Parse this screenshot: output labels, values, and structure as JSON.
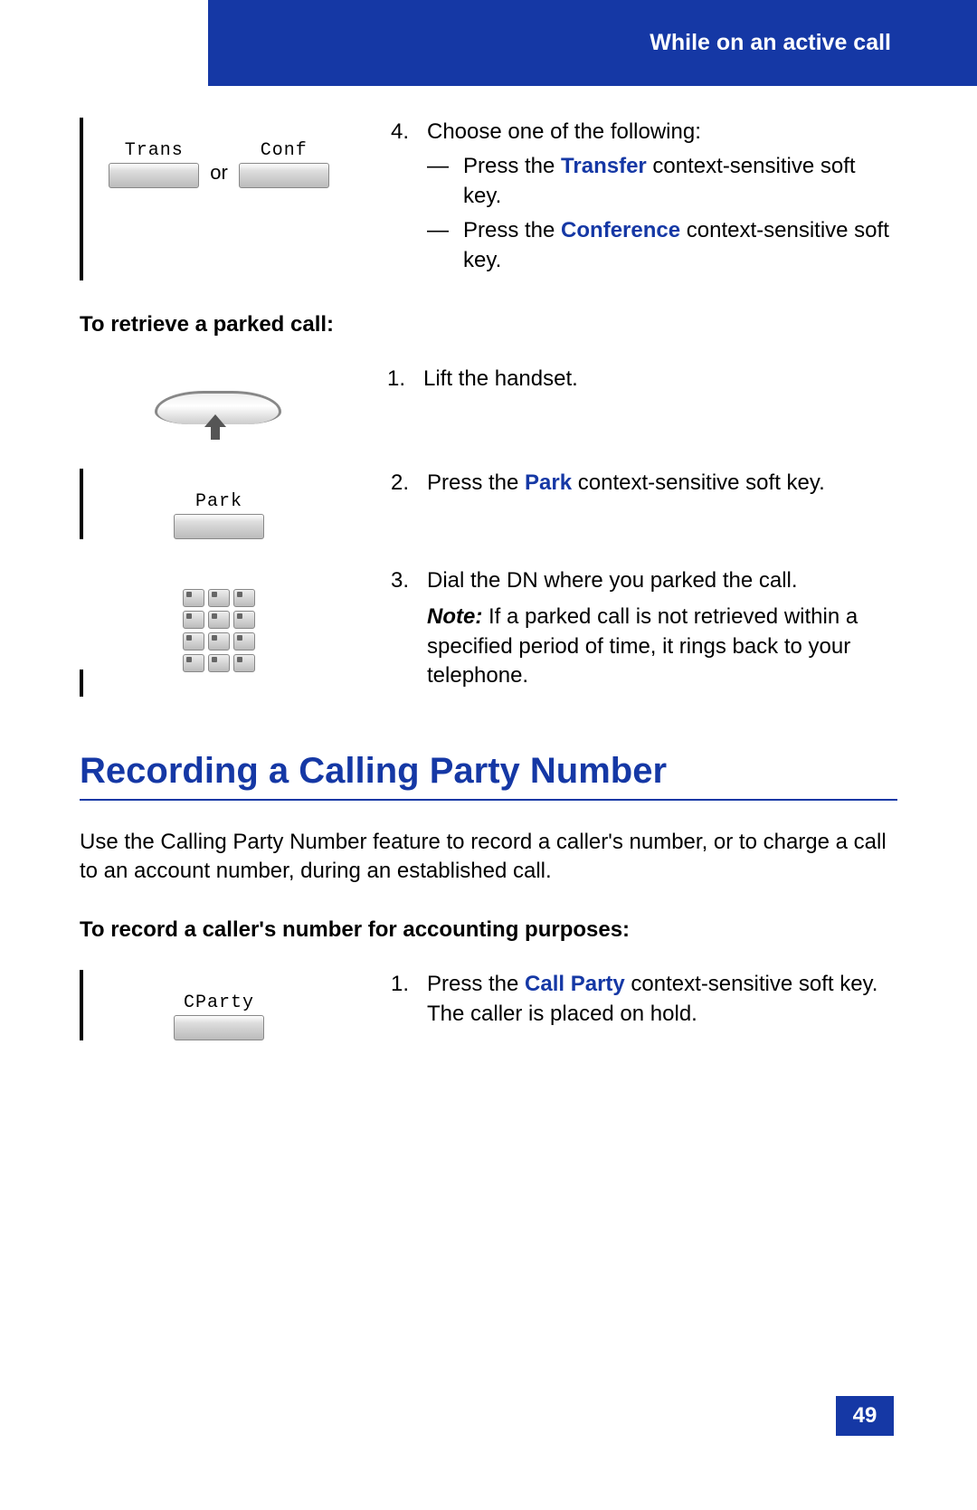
{
  "header": {
    "title": "While on an active call"
  },
  "step4": {
    "num": "4.",
    "lead": "Choose one of the following:",
    "dash": "—",
    "opt1_a": "Press the ",
    "opt1_key": "Transfer",
    "opt1_b": " context-sensitive soft key.",
    "opt2_a": "Press the ",
    "opt2_key": "Conference",
    "opt2_b": " context-sensitive soft key.",
    "key_trans": "Trans",
    "key_conf": "Conf",
    "or": "or"
  },
  "retrieve": {
    "heading": "To retrieve a parked call:",
    "s1_num": "1.",
    "s1_text": "Lift the handset.",
    "s2_num": "2.",
    "s2_a": "Press the ",
    "s2_key": "Park",
    "s2_b": " context-sensitive soft key.",
    "s2_label": "Park",
    "s3_num": "3.",
    "s3_text": "Dial the DN where you parked the call.",
    "s3_note_label": "Note:",
    "s3_note_body": " If a parked call is not retrieved within a specified period of time, it rings back to your telephone."
  },
  "record": {
    "title": "Recording a Calling Party Number",
    "intro": "Use the Calling Party Number feature to record a caller's number, or to charge a call to an account number, during an established call.",
    "subhead": "To record a caller's number for accounting purposes:",
    "s1_num": "1.",
    "s1_a": "Press the ",
    "s1_key": "Call Party",
    "s1_b": " context-sensitive soft key. The caller is placed on hold.",
    "s1_label": "CParty"
  },
  "page_number": "49"
}
